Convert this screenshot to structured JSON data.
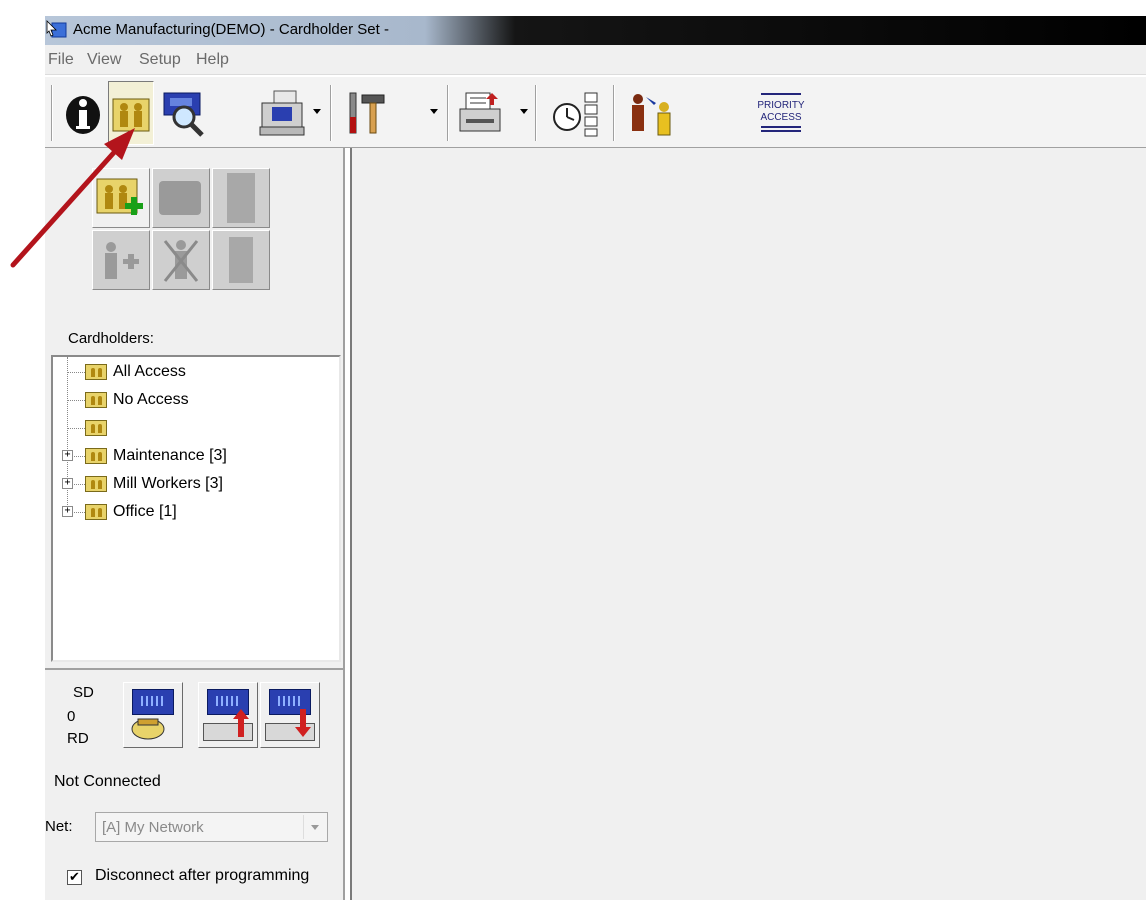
{
  "window": {
    "title": "Acme Manufacturing(DEMO) - Cardholder Set -"
  },
  "menu": [
    "File",
    "View",
    "Setup",
    "Help"
  ],
  "toolbar": {
    "items": [
      {
        "name": "info-button",
        "icon": "info-icon"
      },
      {
        "name": "cardholders-button",
        "icon": "cardholders-icon",
        "pressed": true
      },
      {
        "name": "controller-search-button",
        "icon": "controller-search-icon"
      },
      {
        "name": "computer-dropdown-button",
        "icon": "computer-icon"
      },
      {
        "name": "tools-dropdown-button",
        "icon": "tools-icon"
      },
      {
        "name": "printer-dropdown-button",
        "icon": "printer-icon"
      },
      {
        "name": "schedule-button",
        "icon": "clock-schedule-icon"
      },
      {
        "name": "user-transfer-button",
        "icon": "person-transfer-icon"
      },
      {
        "name": "priority-access-button",
        "icon": "priority-access-icon"
      }
    ],
    "priority_access_label": [
      "PRIORITY",
      "ACCESS"
    ]
  },
  "cardholders_panel": {
    "label": "Cardholders:",
    "tree": [
      {
        "label": "All Access",
        "expandable": false
      },
      {
        "label": "No Access",
        "expandable": false
      },
      {
        "label": "",
        "expandable": false
      },
      {
        "label": "Maintenance [3]",
        "expandable": true
      },
      {
        "label": "Mill Workers [3]",
        "expandable": true
      },
      {
        "label": "Office [1]",
        "expandable": true
      }
    ]
  },
  "connection": {
    "sd_label": "SD",
    "count": "0",
    "rd_label": "RD",
    "status": "Not Connected",
    "net_label": "Net:",
    "net_value": "[A] My Network",
    "disconnect_label": "Disconnect after programming",
    "disconnect_checked": true
  },
  "colors": {
    "annotation_arrow": "#b3141c",
    "folder": "#e8d36a"
  }
}
